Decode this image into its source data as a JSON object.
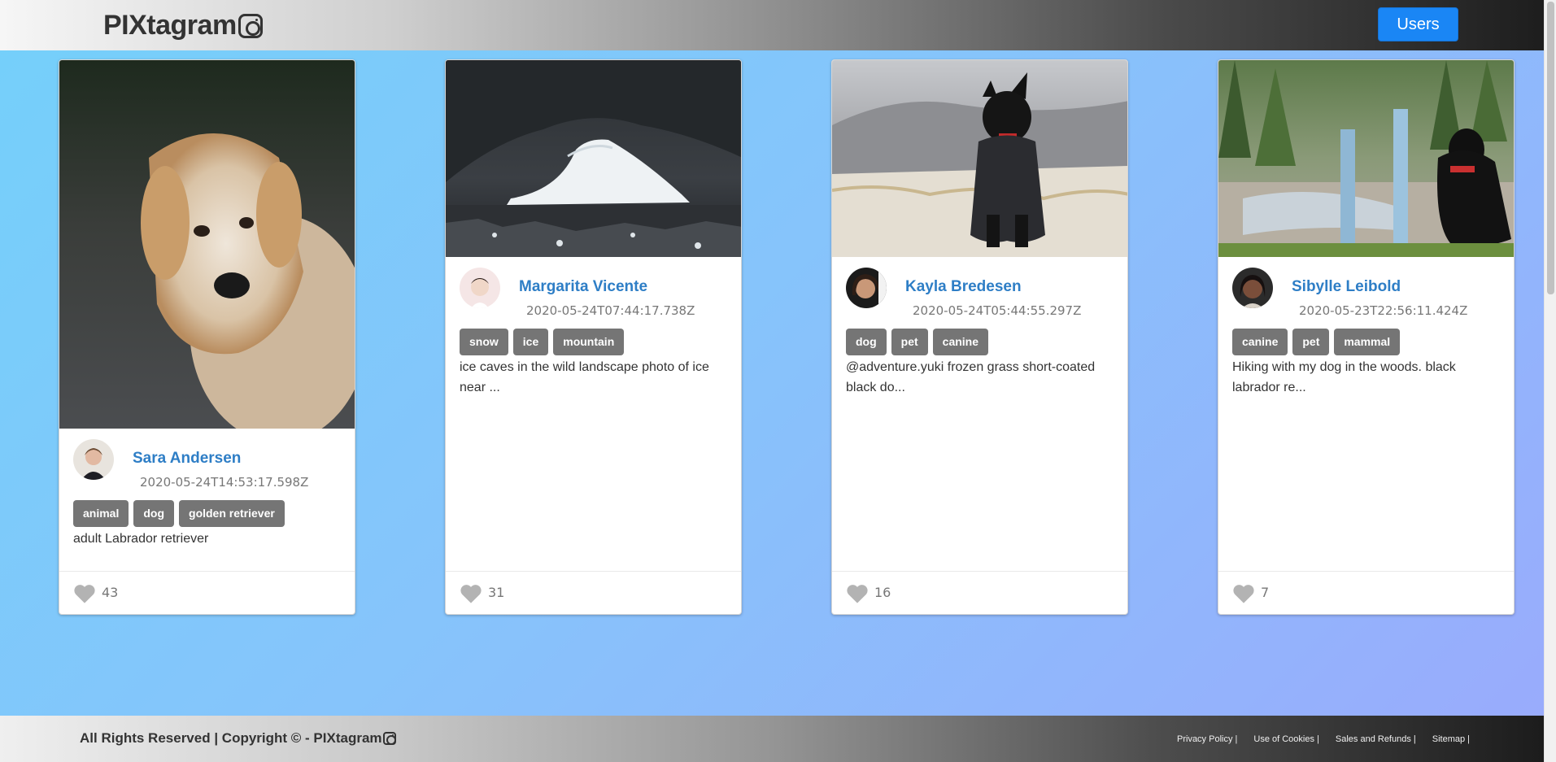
{
  "header": {
    "brand": "PIXtagram",
    "users_button": "Users"
  },
  "posts": [
    {
      "user": "Sara Andersen",
      "date": "2020-05-24T14:53:17.598Z",
      "tags": [
        "animal",
        "dog",
        "golden retriever"
      ],
      "description": "adult Labrador retriever",
      "likes": "43",
      "image_icon": "golden-retriever-photo",
      "avatar_icon": "avatar-icon"
    },
    {
      "user": "Margarita Vicente",
      "date": "2020-05-24T07:44:17.738Z",
      "tags": [
        "snow",
        "ice",
        "mountain"
      ],
      "description": "ice caves in the wild landscape photo of ice near ...",
      "likes": "31",
      "image_icon": "ice-cave-photo",
      "avatar_icon": "avatar-icon"
    },
    {
      "user": "Kayla Bredesen",
      "date": "2020-05-24T05:44:55.297Z",
      "tags": [
        "dog",
        "pet",
        "canine"
      ],
      "description": "@adventure.yuki frozen grass short-coated black do...",
      "likes": "16",
      "image_icon": "black-dog-snow-photo",
      "avatar_icon": "avatar-icon"
    },
    {
      "user": "Sibylle Leibold",
      "date": "2020-05-23T22:56:11.424Z",
      "tags": [
        "canine",
        "pet",
        "mammal"
      ],
      "description": "Hiking with my dog in the woods. black labrador re...",
      "likes": "7",
      "image_icon": "black-labrador-woods-photo",
      "avatar_icon": "avatar-icon"
    }
  ],
  "footer": {
    "copyright": "All Rights Reserved | Copyright © - PIXtagram",
    "links": [
      "Privacy Policy |",
      "Use of Cookies |",
      "Sales and Refunds |",
      "Sitemap |"
    ]
  },
  "colors": {
    "accent_button": "#1a86f5",
    "username": "#2e7ec6",
    "tag_bg": "#757575"
  }
}
